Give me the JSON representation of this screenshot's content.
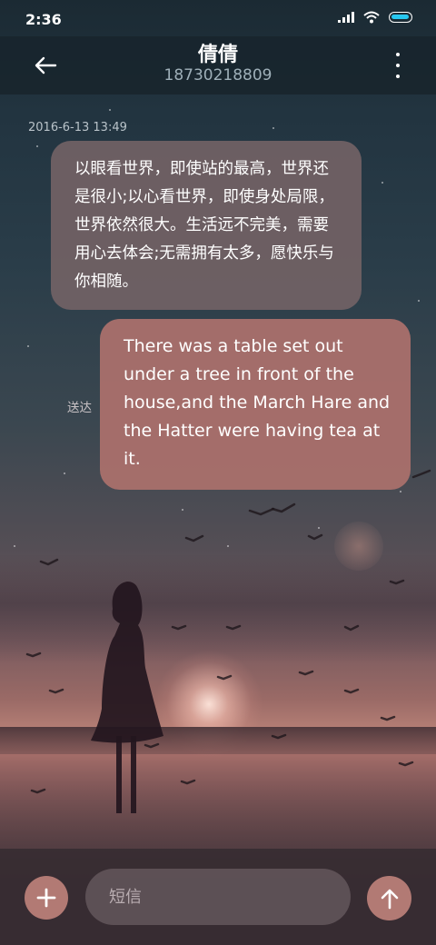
{
  "status_bar": {
    "time": "2:36",
    "icons": [
      "signal-icon",
      "wifi-icon",
      "battery-icon"
    ],
    "battery_color": "#27c8f0"
  },
  "header": {
    "contact_name": "倩倩",
    "contact_number": "18730218809",
    "back_icon": "arrow-left-icon",
    "menu_icon": "more-vertical-icon"
  },
  "conversation": {
    "timestamp": "2016-6-13 13:49",
    "messages": [
      {
        "direction": "incoming",
        "text": "以眼看世界，即使站的最高，世界还是很小;以心看世界，即使身处局限，世界依然很大。生活远不完美，需要用心去体会;无需拥有太多，愿快乐与你相随。"
      },
      {
        "direction": "outgoing",
        "text": "There was a table set out under a tree in front of the house,and the March Hare and the Hatter were having tea at it.",
        "status": "送达"
      }
    ]
  },
  "composer": {
    "add_icon": "plus-icon",
    "placeholder": "短信",
    "value": "",
    "send_icon": "arrow-up-icon",
    "accent_color": "#b27a74"
  }
}
